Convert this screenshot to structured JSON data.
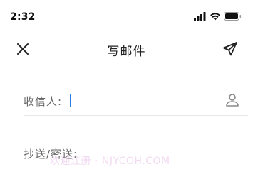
{
  "status_bar": {
    "time": "2:32",
    "icons": [
      "signal-icon",
      "wifi-icon",
      "battery-icon"
    ]
  },
  "header": {
    "title": "写邮件",
    "close_icon": "close-icon",
    "send_icon": "send-icon"
  },
  "fields": {
    "to": {
      "label": "收信人:",
      "value": "",
      "icon": "contact-icon"
    },
    "cc_bcc": {
      "label": "抄送/密送:",
      "value": ""
    }
  },
  "watermark": "欢迎注册 · NJYCOH.COM",
  "colors": {
    "accent": "#2a7de1",
    "text": "#222222",
    "label": "#666666",
    "divider": "#e8e8e8"
  }
}
